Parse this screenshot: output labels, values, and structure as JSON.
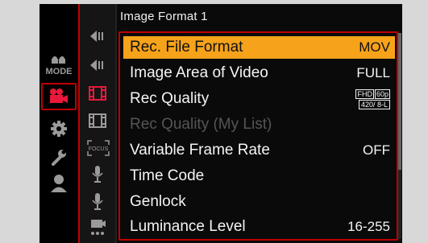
{
  "title": "Image Format 1",
  "mode_label": "MODE",
  "menu": {
    "items": [
      {
        "label": "Rec. File Format",
        "value": "MOV"
      },
      {
        "label": "Image Area of Video",
        "value": "FULL"
      },
      {
        "label": "Rec Quality",
        "value_top_a": "FHD",
        "value_top_b": "60p",
        "value_bottom": "420/ 8-L"
      },
      {
        "label": "Rec Quality (My List)",
        "value": ""
      },
      {
        "label": "Variable Frame Rate",
        "value": "OFF"
      },
      {
        "label": "Time Code",
        "value": ""
      },
      {
        "label": "Genlock",
        "value": ""
      },
      {
        "label": "Luminance Level",
        "value": "16-255"
      }
    ]
  },
  "sub_tabs": {
    "focus_label": "FOCUS"
  },
  "colors": {
    "selection_highlight": "#f6a21b",
    "active_frame": "#c00000",
    "background": "#0a0a0a",
    "text": "#f4f4f4",
    "disabled_text": "#555555",
    "icon": "#9a9a9a"
  },
  "icons": {
    "mode_column": [
      "mode-icon",
      "video-camera-icon",
      "gear-icon",
      "wrench-icon",
      "user-icon"
    ],
    "sub_column": [
      "scroll-up-arrow-icon",
      "scroll-up-arrow-icon",
      "film-strip-icon",
      "film-strip-icon",
      "focus-icon",
      "microphone-icon",
      "microphone-icon",
      "monitor-icon"
    ]
  }
}
